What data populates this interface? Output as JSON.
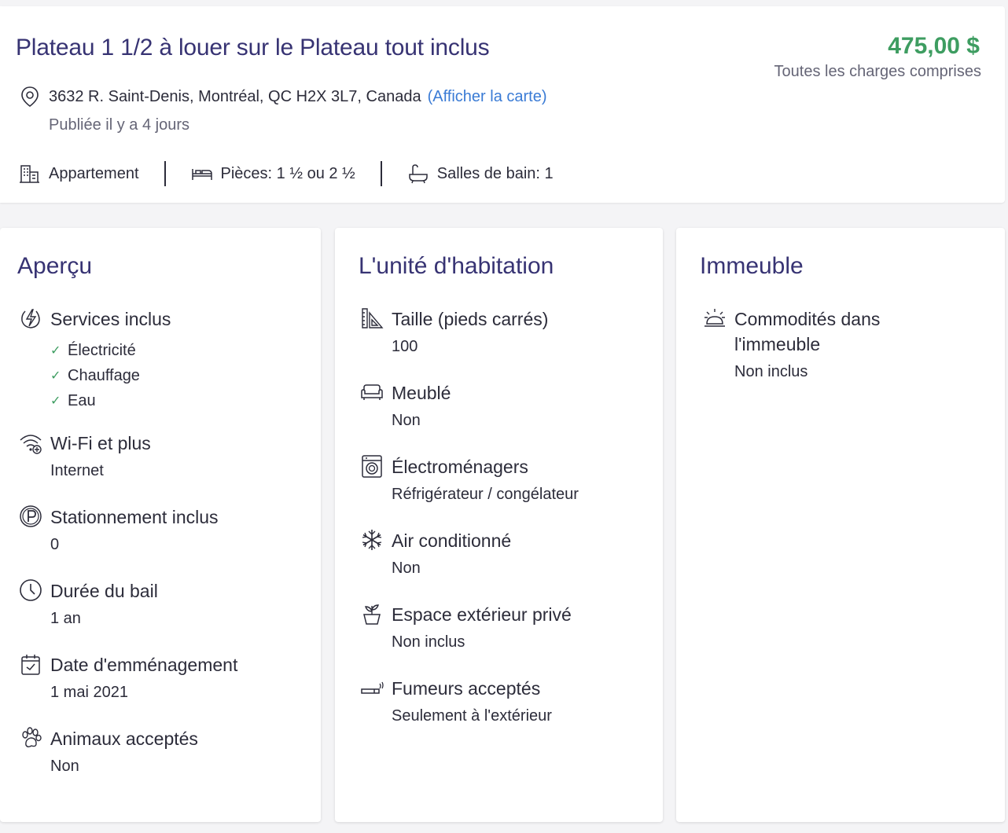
{
  "listing": {
    "title": "Plateau 1 1/2 à louer sur le Plateau tout inclus",
    "price": "475,00 $",
    "price_note": "Toutes les charges comprises",
    "address": "3632 R. Saint-Denis, Montréal, QC H2X 3L7, Canada",
    "map_link": "(Afficher la carte)",
    "published": "Publiée il y a 4 jours",
    "features": {
      "type": "Appartement",
      "rooms": "Pièces: 1 ½ ou 2 ½",
      "bathrooms": "Salles de bain: 1"
    }
  },
  "overview": {
    "title": "Aperçu",
    "services_label": "Services inclus",
    "services": [
      "Électricité",
      "Chauffage",
      "Eau"
    ],
    "wifi_label": "Wi-Fi et plus",
    "wifi_value": "Internet",
    "parking_label": "Stationnement inclus",
    "parking_value": "0",
    "lease_label": "Durée du bail",
    "lease_value": "1 an",
    "move_label": "Date d'emménagement",
    "move_value": "1 mai 2021",
    "pets_label": "Animaux acceptés",
    "pets_value": "Non"
  },
  "unit": {
    "title": "L'unité d'habitation",
    "size_label": "Taille (pieds carrés)",
    "size_value": "100",
    "furnished_label": "Meublé",
    "furnished_value": "Non",
    "appliances_label": "Électroménagers",
    "appliances_value": "Réfrigérateur / congélateur",
    "ac_label": "Air conditionné",
    "ac_value": "Non",
    "outdoor_label": "Espace extérieur privé",
    "outdoor_value": "Non inclus",
    "smoking_label": "Fumeurs acceptés",
    "smoking_value": "Seulement à l'extérieur"
  },
  "building": {
    "title": "Immeuble",
    "amenities_label_1": "Commodités dans",
    "amenities_label_2": "l'immeuble",
    "amenities_value": "Non inclus"
  },
  "colors": {
    "price": "#3e9d61",
    "link": "#3a7bd5",
    "heading": "#373373",
    "check": "#3e9d61"
  }
}
